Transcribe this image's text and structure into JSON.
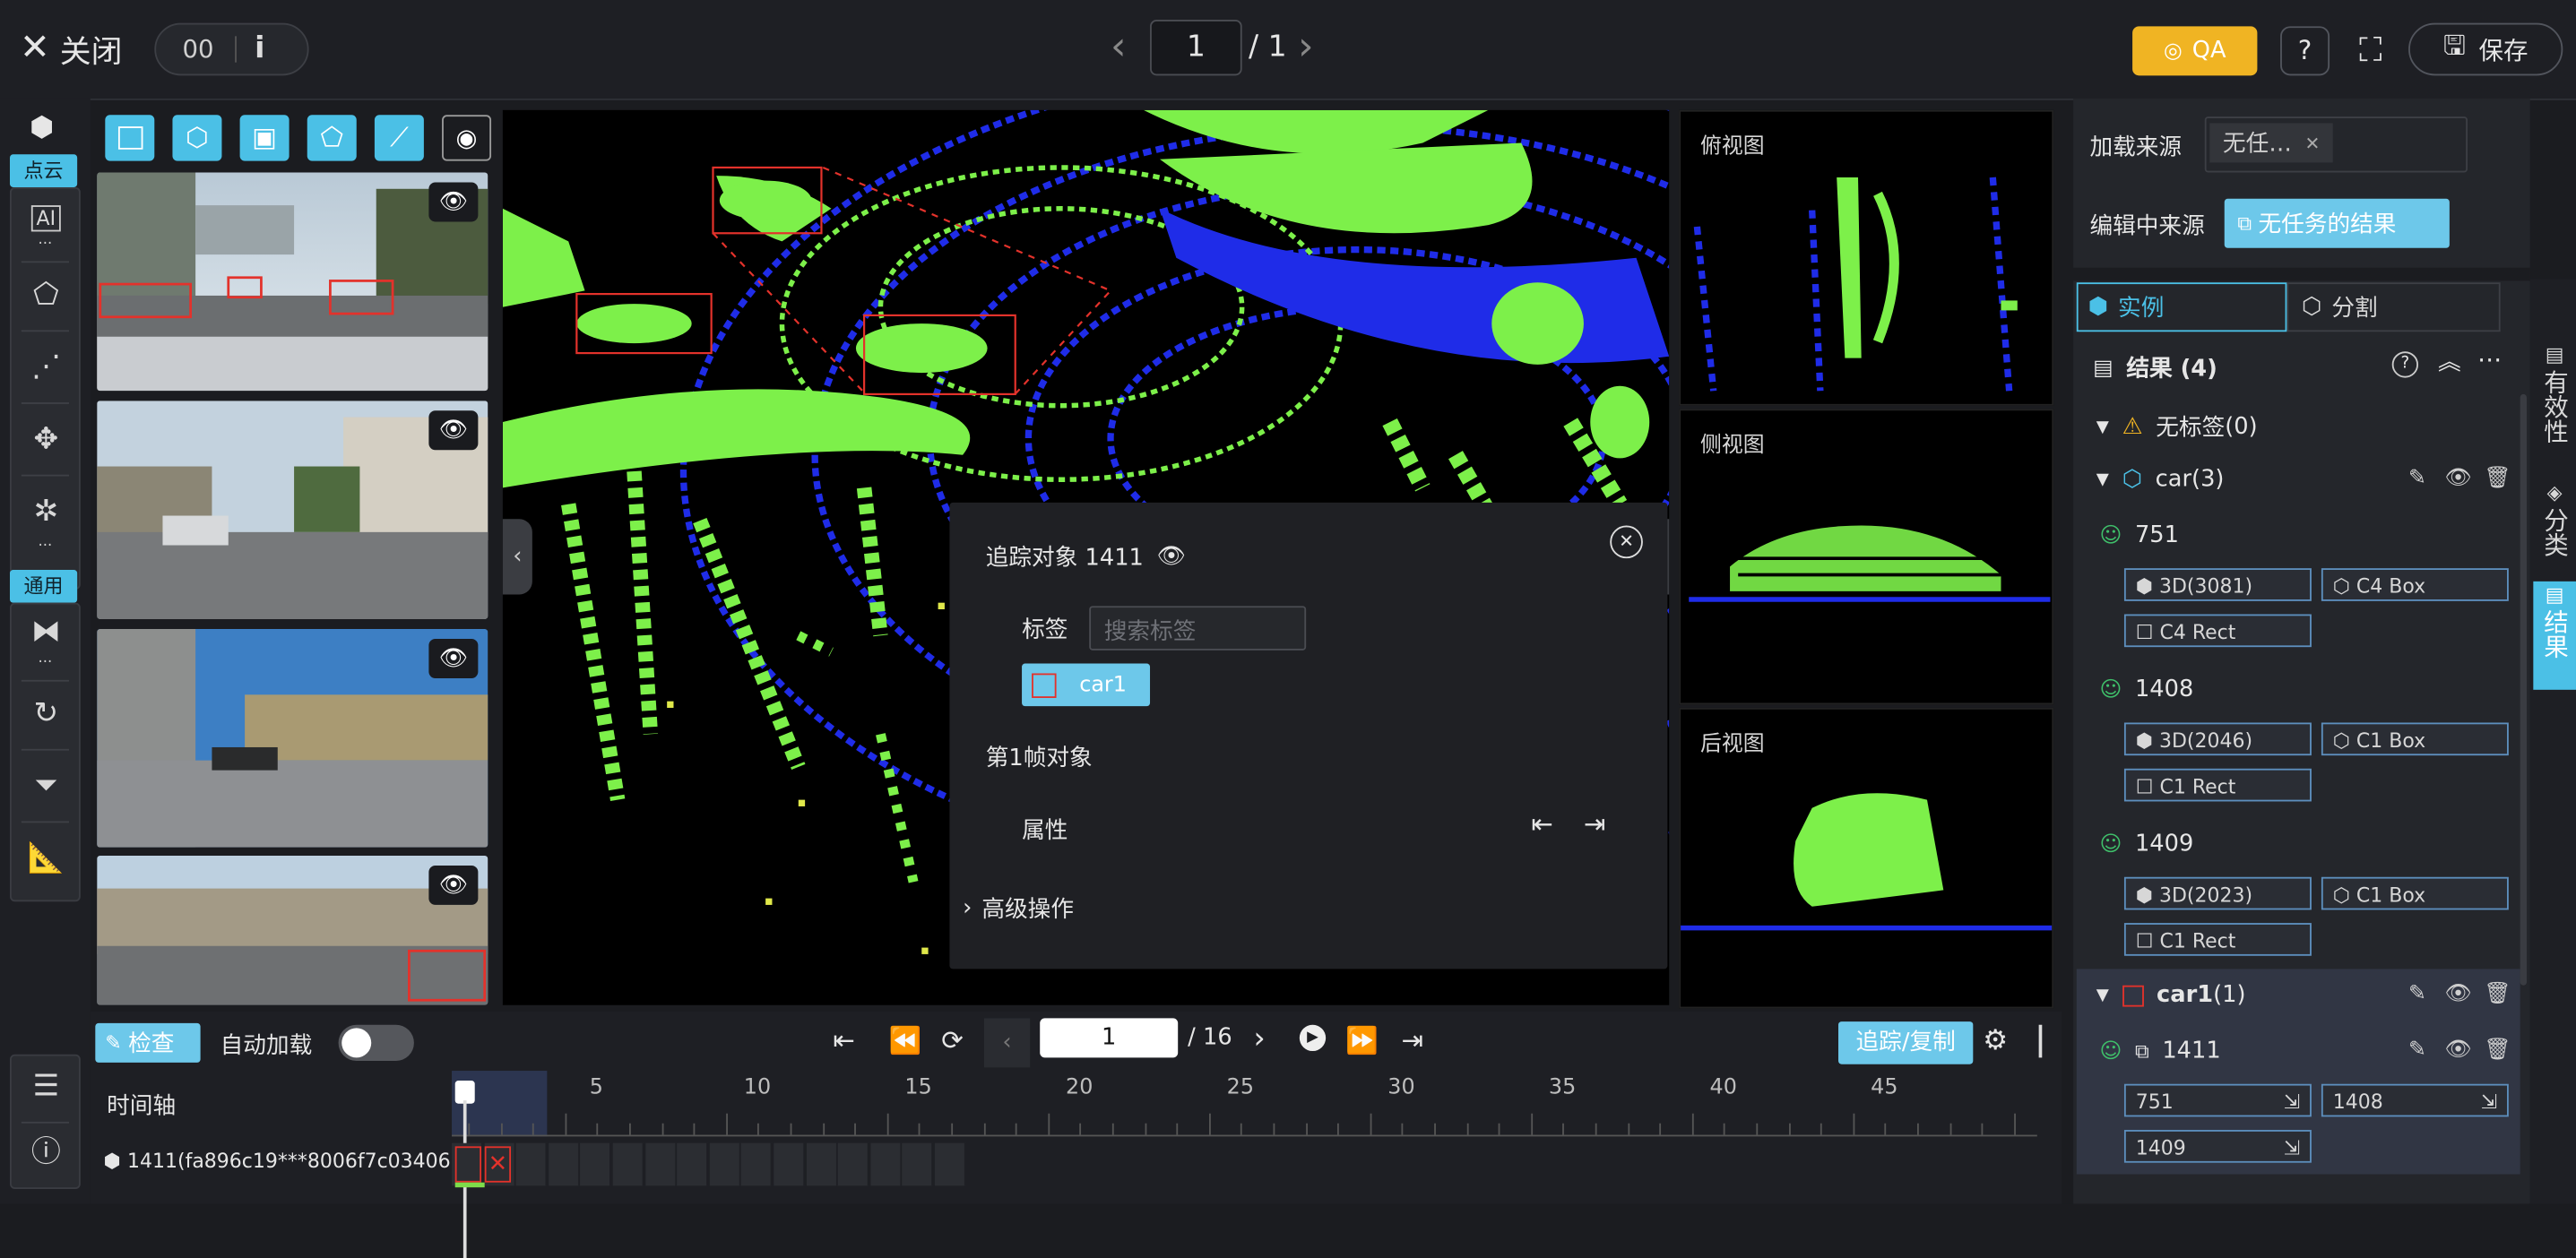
{
  "topbar": {
    "close_label": "关闭",
    "frame_code": "00",
    "page_current": "1",
    "page_total": "/ 1",
    "qa_label": "QA",
    "save_label": "保存",
    "qa_color": "#f0b423"
  },
  "left_tools": {
    "group1_label": "点云",
    "group2_label": "通用",
    "ai_icon_text": "AI"
  },
  "main_popup": {
    "title": "追踪对象 1411",
    "tag_label": "标签",
    "tag_placeholder": "搜索标签",
    "selected_tag": "car1",
    "frame_object": "第1帧对象",
    "attribute_label": "属性",
    "advanced_label": "高级操作"
  },
  "side_views": {
    "top_label": "俯视图",
    "side_label": "侧视图",
    "back_label": "后视图"
  },
  "right_panel": {
    "load_source_label": "加载来源",
    "load_source_value": "无任…",
    "edit_source_label": "编辑中来源",
    "edit_source_value": "无任务的结果",
    "tab_instance": "实例",
    "tab_segment": "分割",
    "results_title": "结果 (4)",
    "groups": [
      {
        "name": "无标签",
        "count": "(0)"
      },
      {
        "name": "car",
        "count": "(3)"
      },
      {
        "name": "car1",
        "count": "(1)"
      }
    ],
    "car_items": [
      {
        "id": "751",
        "tags": [
          "3D(3081)",
          "C4 Box",
          "C4 Rect"
        ]
      },
      {
        "id": "1408",
        "tags": [
          "3D(2046)",
          "C1 Box",
          "C1 Rect"
        ]
      },
      {
        "id": "1409",
        "tags": [
          "3D(2023)",
          "C1 Box",
          "C1 Rect"
        ]
      }
    ],
    "car1_item": {
      "id": "1411",
      "links": [
        "751",
        "1408",
        "1409"
      ]
    }
  },
  "far_right_tabs": [
    "有效性",
    "分类",
    "结果"
  ],
  "bottom": {
    "check_label": "检查",
    "autoload_label": "自动加载",
    "frame_current": "1",
    "frame_total": "/ 16",
    "track_copy_label": "追踪/复制",
    "timeline_label": "时间轴",
    "track_name": "1411(fa896c19***8006f7c03406)",
    "ticks": [
      "5",
      "10",
      "15",
      "20",
      "25",
      "30",
      "35",
      "40",
      "45"
    ]
  },
  "colors": {
    "accent": "#4bc0e6",
    "points_green": "#7df04a",
    "points_blue": "#1f2ce8",
    "box_red": "#e3322b"
  }
}
